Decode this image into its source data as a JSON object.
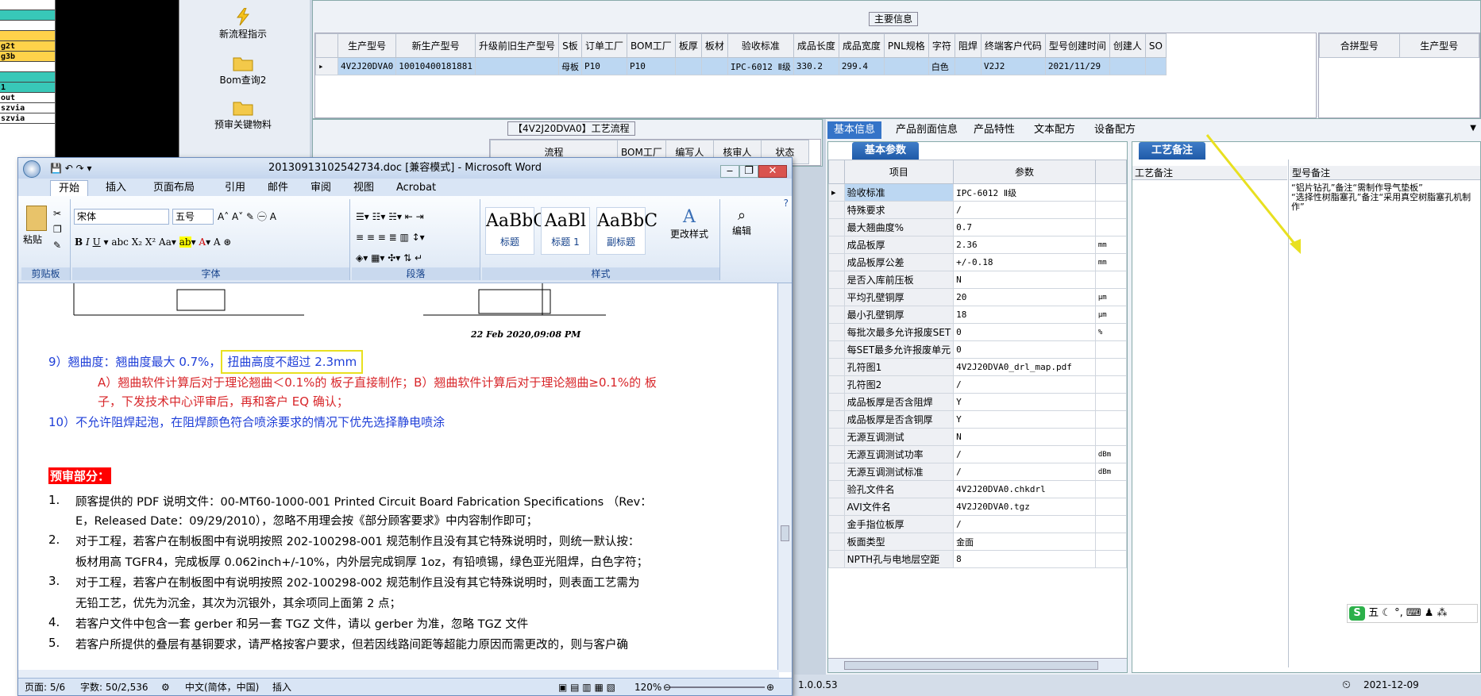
{
  "left_strip": [
    {
      "text": "",
      "bg": "#ffffff"
    },
    {
      "text": "",
      "bg": "#38c8b8"
    },
    {
      "text": "",
      "bg": "#ffffff"
    },
    {
      "text": "",
      "bg": "#ffd24a"
    },
    {
      "text": "g2t",
      "bg": "#ffd24a"
    },
    {
      "text": "g3b",
      "bg": "#ffd24a"
    },
    {
      "text": "",
      "bg": "#ffffff"
    },
    {
      "text": "",
      "bg": "#38c8b8"
    },
    {
      "text": "1",
      "bg": "#38c8b8"
    },
    {
      "text": "out",
      "bg": "#ffffff"
    },
    {
      "text": "szvia",
      "bg": "#ffffff"
    },
    {
      "text": "szvia",
      "bg": "#ffffff"
    }
  ],
  "sidebar": {
    "items": [
      "新流程指示",
      "Bom查询2",
      "预审关键物料"
    ]
  },
  "main_info": {
    "caption": "主要信息",
    "columns": [
      "生产型号",
      "新生产型号",
      "升级前旧生产型号",
      "S板",
      "订单工厂",
      "BOM工厂",
      "板厚",
      "板材",
      "验收标准",
      "成品长度",
      "成品宽度",
      "PNL规格",
      "字符",
      "阻焊",
      "终端客户代码",
      "型号创建时间",
      "创建人",
      "SO"
    ],
    "row": [
      "4V2J20DVA0",
      "10010400181881",
      "",
      "母板",
      "P10",
      "P10",
      "",
      "",
      "IPC-6012 Ⅱ级",
      "330.2",
      "299.4",
      "",
      "白色",
      "",
      "V2J2",
      "2021/11/29",
      "",
      ""
    ],
    "merge_columns": [
      "合拼型号",
      "生产型号"
    ]
  },
  "process": {
    "caption": "【4V2J20DVA0】工艺流程",
    "columns": [
      "流程",
      "BOM工厂",
      "编写人",
      "核审人",
      "状态"
    ]
  },
  "right_tabs": [
    "基本信息",
    "产品剖面信息",
    "产品特性",
    "文本配方",
    "设备配方"
  ],
  "basic": {
    "tab": "基本参数",
    "columns": [
      "项目",
      "参数"
    ],
    "rows": [
      {
        "item": "验收标准",
        "value": "IPC-6012 Ⅱ级",
        "unit": ""
      },
      {
        "item": "特殊要求",
        "value": "/",
        "unit": ""
      },
      {
        "item": "最大翘曲度%",
        "value": "0.7",
        "unit": ""
      },
      {
        "item": "成品板厚",
        "value": "2.36",
        "unit": "mm"
      },
      {
        "item": "成品板厚公差",
        "value": "+/-0.18",
        "unit": "mm"
      },
      {
        "item": "是否入库前压板",
        "value": "N",
        "unit": ""
      },
      {
        "item": "平均孔壁铜厚",
        "value": "20",
        "unit": "μm"
      },
      {
        "item": "最小孔壁铜厚",
        "value": "18",
        "unit": "μm"
      },
      {
        "item": "每批次最多允许报废SET",
        "value": "0",
        "unit": "%"
      },
      {
        "item": "每SET最多允许报废单元",
        "value": "0",
        "unit": ""
      },
      {
        "item": "孔符图1",
        "value": "4V2J20DVA0_drl_map.pdf",
        "unit": ""
      },
      {
        "item": "孔符图2",
        "value": "/",
        "unit": ""
      },
      {
        "item": "成品板厚是否含阻焊",
        "value": "Y",
        "unit": ""
      },
      {
        "item": "成品板厚是否含铜厚",
        "value": "Y",
        "unit": ""
      },
      {
        "item": "无源互调测试",
        "value": "N",
        "unit": ""
      },
      {
        "item": "无源互调测试功率",
        "value": "/",
        "unit": "dBm"
      },
      {
        "item": "无源互调测试标准",
        "value": "/",
        "unit": "dBm"
      },
      {
        "item": "验孔文件名",
        "value": "4V2J20DVA0.chkdrl",
        "unit": ""
      },
      {
        "item": "AVI文件名",
        "value": "4V2J20DVA0.tgz",
        "unit": ""
      },
      {
        "item": "金手指位板厚",
        "value": "/",
        "unit": ""
      },
      {
        "item": "板面类型",
        "value": "金面",
        "unit": ""
      },
      {
        "item": "NPTH孔与电地层空距",
        "value": "8",
        "unit": ""
      }
    ]
  },
  "craft": {
    "tab": "工艺备注",
    "columns": [
      "工艺备注",
      "型号备注"
    ],
    "model_note": "“铝片钻孔”备注“需制作导气垫板”\n“选择性树脂塞孔”备注“采用真空树脂塞孔机制作”"
  },
  "word": {
    "title": "20130913102542734.doc [兼容模式] - Microsoft Word",
    "tabs": [
      "开始",
      "插入",
      "页面布局",
      "引用",
      "邮件",
      "审阅",
      "视图",
      "Acrobat"
    ],
    "font_name": "宋体",
    "font_size": "五号",
    "groups": [
      "剪贴板",
      "字体",
      "段落",
      "样式",
      "编辑"
    ],
    "paste_label": "粘贴",
    "styles": [
      {
        "preview": "AaBbC",
        "name": "标题"
      },
      {
        "preview": "AaBl",
        "name": "标题 1"
      },
      {
        "preview": "AaBbC",
        "name": "副标题"
      }
    ],
    "change_style": "更改样式",
    "edit": "编辑",
    "stamp": "22 Feb 2020,09:08 PM",
    "line9a": "9）翘曲度：翘曲度最大 0.7%，",
    "line9b": "扭曲高度不超过 2.3mm",
    "lineA": "A）翘曲软件计算后对于理论翘曲＜0.1%的  板子直接制作；B）翘曲软件计算后对于理论翘曲≥0.1%的  板",
    "lineA2": "子，下发技术中心评审后，再和客户 EQ 确认；",
    "line10": "10）不允许阻焊起泡，在阻焊颜色符合喷涂要求的情况下优先选择静电喷涂",
    "pre_heading": "预审部分：",
    "items": [
      "顾客提供的 PDF 说明文件：00-MT60-1000-001 Printed Circuit Board Fabrication Specifications （Rev：",
      "E，Released Date：09/29/2010），忽略不用理会按《部分顾客要求》中内容制作即可；",
      "对于工程，若客户在制板图中有说明按照 202-100298-001 规范制作且没有其它特殊说明时，则统一默认按：",
      "板材用高 TGFR4，完成板厚 0.062inch+/-10%，内外层完成铜厚 1oz，有铅喷锡，绿色亚光阻焊，白色字符；",
      "对于工程，若客户在制板图中有说明按照 202-100298-002 规范制作且没有其它特殊说明时，则表面工艺需为",
      "无铅工艺，优先为沉金，其次为沉银外，其余项同上面第 2 点；",
      "若客户文件中包含一套 gerber 和另一套 TGZ 文件，请以 gerber 为准，忽略 TGZ 文件",
      "若客户所提供的叠层有基铜要求，请严格按客户要求，但若因线路间距等超能力原因而需更改的，则与客户确"
    ],
    "item_numbers": [
      "1.",
      "2.",
      "3.",
      "4.",
      "5."
    ],
    "status_page": "页面: 5/6",
    "status_words": "字数: 50/2,536",
    "status_lang": "中文(简体，中国)",
    "status_mode": "插入",
    "zoom": "120%"
  },
  "app_status": {
    "version": "1.0.0.53",
    "date": "2021-12-09",
    "ime": "五"
  },
  "colors": {
    "accent": "#3574c8",
    "highlight_box": "#e8e020",
    "arrow": "#e8e020",
    "red_block": "#ff0000"
  }
}
